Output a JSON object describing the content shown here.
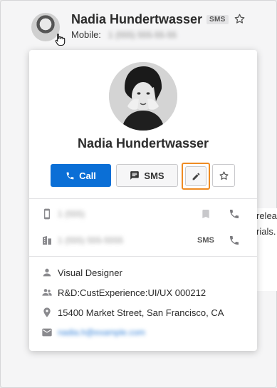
{
  "header": {
    "name": "Nadia Hundertwasser",
    "sms_badge": "SMS",
    "mobile_label": "Mobile:",
    "mobile_number": "1 (555) 555-55-55",
    "icons": [
      "contact-avatar",
      "hand-cursor-icon",
      "star-outline-icon"
    ]
  },
  "background_text": [
    "relea",
    "rials."
  ],
  "card": {
    "name": "Nadia Hundertwasser",
    "actions": {
      "call_label": "Call",
      "sms_label": "SMS",
      "icons": [
        "phone-icon",
        "message-icon",
        "pencil-icon",
        "star-outline-icon"
      ]
    },
    "phones": [
      {
        "type_icon": "mobile-phone-icon",
        "value": "1 (555)",
        "actions": [
          "bookmark-icon",
          "phone-icon"
        ]
      },
      {
        "type_icon": "building-icon",
        "value": "1 (555) 555-5555",
        "sms_label": "SMS",
        "actions": [
          "phone-icon"
        ]
      }
    ],
    "details": {
      "title": "Visual Designer",
      "department": "R&D:CustExperience:UI/UX 000212",
      "address": "15400 Market Street, San Francisco, CA",
      "email": "nadia.h@example.com"
    },
    "accent_colors": {
      "primary": "#0b6fd6",
      "focus": "#ef8b22"
    }
  }
}
